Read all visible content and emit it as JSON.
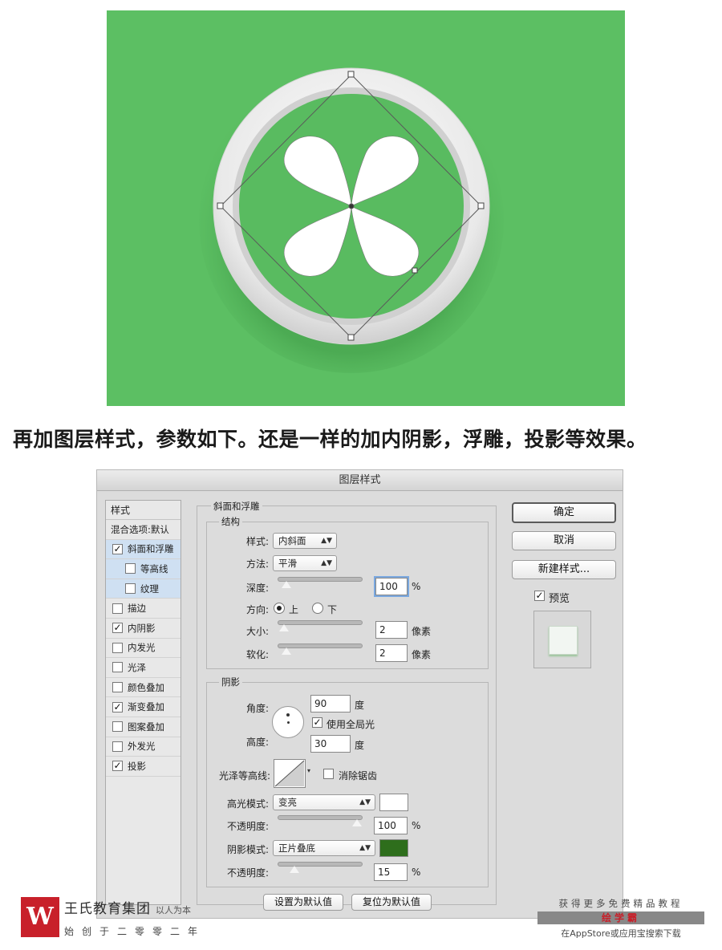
{
  "illustration": {
    "bg_color": "#5cbf63",
    "ring_color": "#eeeeee",
    "petal_color": "#ffffff"
  },
  "caption": "再加图层样式，参数如下。还是一样的加内阴影，浮雕，投影等效果。",
  "dialog": {
    "title": "图层样式",
    "styles_header": "样式",
    "blend_options": "混合选项:默认",
    "style_items": [
      {
        "label": "斜面和浮雕",
        "checked": "✓"
      },
      {
        "label": "等高线",
        "checked": ""
      },
      {
        "label": "纹理",
        "checked": ""
      },
      {
        "label": "描边",
        "checked": ""
      },
      {
        "label": "内阴影",
        "checked": "✓"
      },
      {
        "label": "内发光",
        "checked": ""
      },
      {
        "label": "光泽",
        "checked": ""
      },
      {
        "label": "颜色叠加",
        "checked": ""
      },
      {
        "label": "渐变叠加",
        "checked": "✓"
      },
      {
        "label": "图案叠加",
        "checked": ""
      },
      {
        "label": "外发光",
        "checked": ""
      },
      {
        "label": "投影",
        "checked": "✓"
      }
    ],
    "bevel_title": "斜面和浮雕",
    "structure": {
      "title": "结构",
      "style_label": "样式:",
      "style_value": "内斜面",
      "technique_label": "方法:",
      "technique_value": "平滑",
      "depth_label": "深度:",
      "depth_value": "100",
      "depth_unit": "%",
      "direction_label": "方向:",
      "direction_up": "上",
      "direction_down": "下",
      "size_label": "大小:",
      "size_value": "2",
      "size_unit": "像素",
      "soften_label": "软化:",
      "soften_value": "2",
      "soften_unit": "像素",
      "depth_slider_pct": 4,
      "size_slider_pct": 1,
      "soften_slider_pct": 4
    },
    "shading": {
      "title": "阴影",
      "angle_label": "角度:",
      "angle_value": "90",
      "angle_unit": "度",
      "global_light_label": "使用全局光",
      "global_light_check": "✓",
      "altitude_label": "高度:",
      "altitude_value": "30",
      "altitude_unit": "度",
      "gloss_contour_label": "光泽等高线:",
      "anti_alias_label": "消除锯齿",
      "anti_alias_check": "",
      "highlight_mode_label": "高光模式:",
      "highlight_mode_value": "变亮",
      "highlight_color": "#ffffff",
      "highlight_opacity_label": "不透明度:",
      "highlight_opacity_value": "100",
      "highlight_opacity_unit": "%",
      "highlight_opacity_pct": 100,
      "shadow_mode_label": "阴影模式:",
      "shadow_mode_value": "正片叠底",
      "shadow_color": "#2e6e1c",
      "shadow_opacity_label": "不透明度:",
      "shadow_opacity_value": "15",
      "shadow_opacity_unit": "%",
      "shadow_opacity_pct": 15
    },
    "make_default": "设置为默认值",
    "reset_default": "复位为默认值",
    "ok": "确定",
    "cancel": "取消",
    "new_style": "新建样式...",
    "preview_label": "预览",
    "preview_check": "✓"
  },
  "footer": {
    "logo_letter": "W",
    "brand": "王氏教育集团",
    "motto": "以人为本",
    "founded": "始创于二零零二年",
    "promo_line1": "获得更多免费精品教程",
    "promo_app": "绘学霸",
    "promo_line3": "在AppStore或应用宝搜索下载"
  }
}
